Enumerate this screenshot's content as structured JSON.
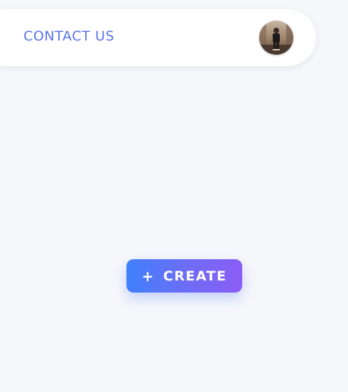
{
  "navbar": {
    "contact_label": "CONTACT US",
    "avatar_icon": "user-avatar-photo"
  },
  "main": {
    "create_button": {
      "icon": "+",
      "label": "CREATE"
    }
  },
  "colors": {
    "background": "#f6f7fb",
    "nav_link": "#5b73ea",
    "button_gradient_start": "#3f80fb",
    "button_gradient_end": "#8b5cf6"
  }
}
